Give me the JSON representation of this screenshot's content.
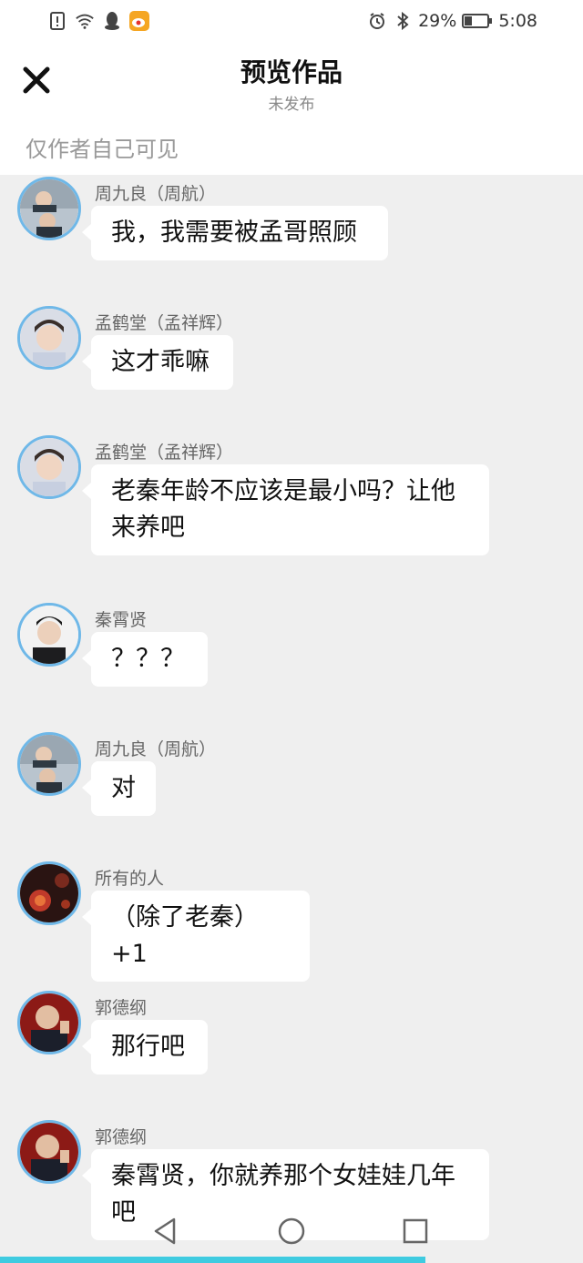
{
  "status_bar": {
    "battery": "29%",
    "time": "5:08"
  },
  "header": {
    "title": "预览作品",
    "subtitle": "未发布",
    "visibility_note": "仅作者自己可见"
  },
  "messages": [
    {
      "name": "周九良（周航）",
      "text": "我，我需要被孟哥照顾",
      "avatar": "avatar-zhou"
    },
    {
      "name": "孟鹤堂（孟祥辉）",
      "text": "这才乖嘛",
      "avatar": "avatar-meng"
    },
    {
      "name": "孟鹤堂（孟祥辉）",
      "text": "老秦年龄不应该是最小吗？让他来养吧",
      "avatar": "avatar-meng"
    },
    {
      "name": "秦霄贤",
      "text": "？？？",
      "avatar": "avatar-qin"
    },
    {
      "name": "周九良（周航）",
      "text": "对",
      "avatar": "avatar-zhou"
    },
    {
      "name": "所有的人",
      "text": "（除了老秦）+1",
      "avatar": "avatar-all"
    },
    {
      "name": "郭德纲",
      "text": "那行吧",
      "avatar": "avatar-guo"
    },
    {
      "name": "郭德纲",
      "text": "秦霄贤，你就养那个女娃娃几年吧",
      "avatar": "avatar-guo"
    }
  ],
  "progress": 0.73
}
